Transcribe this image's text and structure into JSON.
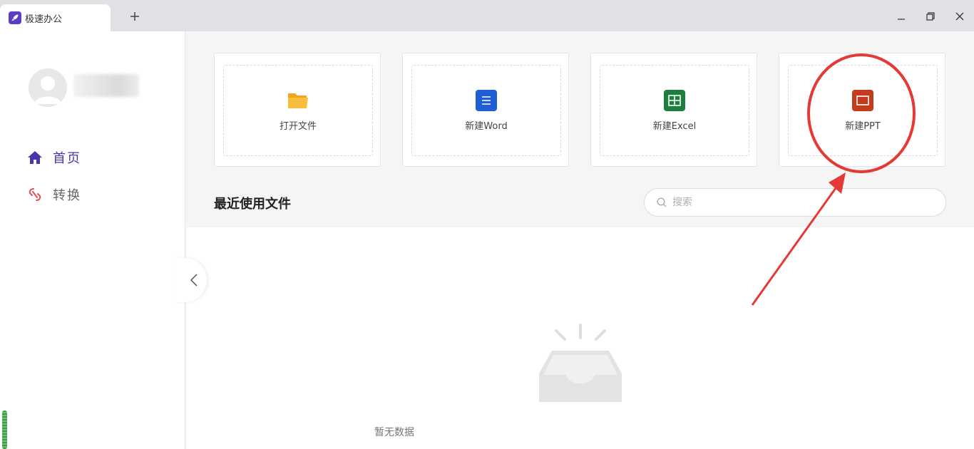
{
  "window": {
    "tab_title": "极速办公",
    "colors": {
      "brand": "#5b3cc4",
      "accent": "#4a35a8"
    }
  },
  "sidebar": {
    "items": [
      {
        "label": "首页",
        "icon": "home-icon",
        "active": true
      },
      {
        "label": "转换",
        "icon": "convert-link-icon",
        "active": false
      }
    ]
  },
  "cards": [
    {
      "label": "打开文件",
      "icon": "folder-icon",
      "color": "#f7a825"
    },
    {
      "label": "新建Word",
      "icon": "word-doc-icon",
      "color": "#1f5fd6"
    },
    {
      "label": "新建Excel",
      "icon": "excel-sheet-icon",
      "color": "#1e7e3e"
    },
    {
      "label": "新建PPT",
      "icon": "ppt-slide-icon",
      "color": "#c43b1d"
    }
  ],
  "recent": {
    "title": "最近使用文件",
    "search_placeholder": "搜索",
    "empty_text": "暂无数据"
  },
  "annotation": {
    "color": "#e53935"
  }
}
